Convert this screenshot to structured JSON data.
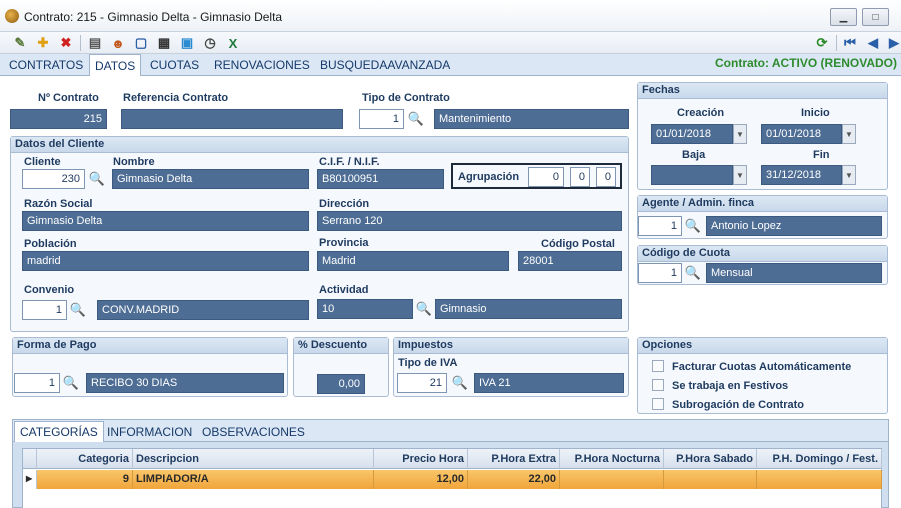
{
  "window": {
    "title": "Contrato: 215 - Gimnasio Delta - Gimnasio Delta"
  },
  "toolbar": {
    "icons": [
      "edit-icon",
      "add-icon",
      "delete-icon",
      "print-icon",
      "users-icon",
      "window-icon",
      "calculator-icon",
      "image-icon",
      "clock-icon",
      "excel-icon",
      "refresh-icon",
      "first-icon",
      "prev-icon",
      "next-icon"
    ]
  },
  "tabs": [
    "CONTRATOS",
    "DATOS",
    "CUOTAS",
    "RENOVACIONES",
    "BUSQUEDAAVANZADA"
  ],
  "status": "Contrato: ACTIVO (RENOVADO)",
  "contract": {
    "num_label": "Nº Contrato",
    "num": "215",
    "ref_label": "Referencia Contrato",
    "ref": "",
    "type_label": "Tipo de Contrato",
    "type_code": "1",
    "type_name": "Mantenimiento"
  },
  "client": {
    "panel_title": "Datos del Cliente",
    "cliente_label": "Cliente",
    "cliente": "230",
    "nombre_label": "Nombre",
    "nombre": "Gimnasio Delta",
    "cif_label": "C.I.F. / N.I.F.",
    "cif": "B80100951",
    "agrupacion_label": "Agrupación",
    "agrupacion": [
      "0",
      "0",
      "0"
    ],
    "razon_label": "Razón Social",
    "razon": "Gimnasio Delta",
    "direccion_label": "Dirección",
    "direccion": "Serrano 120",
    "poblacion_label": "Población",
    "poblacion": "madrid",
    "provincia_label": "Provincia",
    "provincia": "Madrid",
    "cp_label": "Código Postal",
    "cp": "28001",
    "convenio_label": "Convenio",
    "convenio_code": "1",
    "convenio_name": "CONV.MADRID",
    "actividad_label": "Actividad",
    "actividad_code": "10",
    "actividad_name": "Gimnasio"
  },
  "fechas": {
    "panel_title": "Fechas",
    "creacion_label": "Creación",
    "creacion": "01/01/2018",
    "inicio_label": "Inicio",
    "inicio": "01/01/2018",
    "baja_label": "Baja",
    "baja": "",
    "fin_label": "Fin",
    "fin": "31/12/2018"
  },
  "agente": {
    "panel_title": "Agente / Admin. finca",
    "code": "1",
    "name": "Antonio Lopez"
  },
  "cuota": {
    "panel_title": "Código de Cuota",
    "code": "1",
    "name": "Mensual"
  },
  "pago": {
    "panel_title": "Forma de Pago",
    "code": "1",
    "name": "RECIBO 30 DIAS"
  },
  "descuento": {
    "panel_title": "% Descuento",
    "value": "0,00"
  },
  "impuestos": {
    "panel_title": "Impuestos",
    "iva_label": "Tipo de IVA",
    "code": "21",
    "name": "IVA 21"
  },
  "opciones": {
    "panel_title": "Opciones",
    "items": [
      "Facturar Cuotas Automáticamente",
      "Se trabaja en Festivos",
      "Subrogación de Contrato"
    ]
  },
  "grid": {
    "tabs": [
      "CATEGORÍAS",
      "INFORMACION",
      "OBSERVACIONES"
    ],
    "headers": [
      "Categoria",
      "Descripcion",
      "Precio Hora",
      "P.Hora Extra",
      "P.Hora Nocturna",
      "P.Hora Sabado",
      "P.H. Domingo / Fest."
    ],
    "row": [
      "9",
      "LIMPIADOR/A",
      "12,00",
      "22,00",
      "",
      "",
      ""
    ]
  },
  "colors": {
    "field_bg": "#4e6d94",
    "status_green": "#2e8b2e",
    "row_highlight": "#f0a53a"
  }
}
